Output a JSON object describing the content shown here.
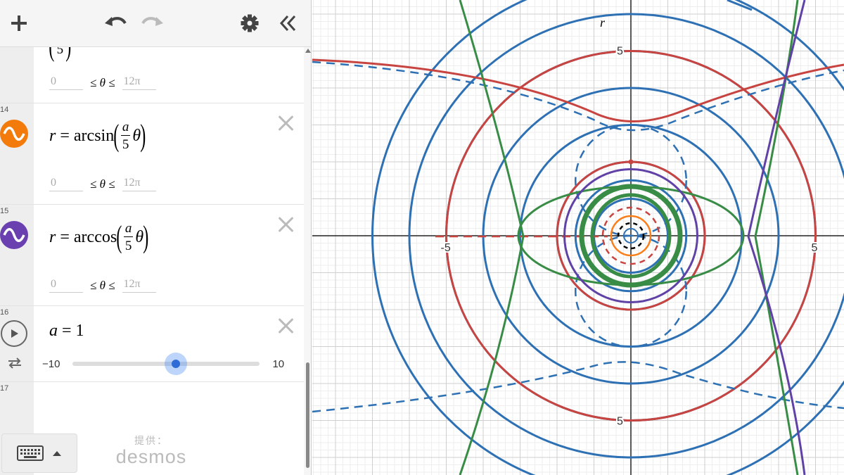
{
  "toolbar": {
    "add_icon": "plus-icon",
    "undo_icon": "undo-icon",
    "redo_icon": "redo-icon",
    "settings_icon": "gear-icon",
    "collapse_icon": "double-chevron-left-icon"
  },
  "expressions": {
    "partial": {
      "frac_den": "5",
      "dom_min": "0",
      "dom_max": "12π",
      "dom_var": "θ"
    },
    "e14": {
      "num": "14",
      "color": "#f27b0c",
      "lhs": "r",
      "func": "arcsin",
      "frac_num": "a",
      "frac_den": "5",
      "var": "θ",
      "dom_min": "0",
      "dom_max": "12π",
      "dom_var": "θ"
    },
    "e15": {
      "num": "15",
      "color": "#6a3fb0",
      "lhs": "r",
      "func": "arccos",
      "frac_num": "a",
      "frac_den": "5",
      "var": "θ",
      "dom_min": "0",
      "dom_max": "12π",
      "dom_var": "θ"
    },
    "e16": {
      "num": "16",
      "lhs": "a",
      "eq": "= 1",
      "slider_min": "−10",
      "slider_max": "10",
      "slider_value": 1
    },
    "e17": {
      "num": "17"
    }
  },
  "footer": {
    "keyboard_icon": "keyboard-icon",
    "powered_by": "提供：",
    "brand": "desmos"
  },
  "graph": {
    "x_label": "r",
    "x_ticks": [
      "-5",
      "5"
    ],
    "y_ticks": [
      "5",
      "5"
    ],
    "colors": {
      "blue": "#2d70b3",
      "red": "#c74440",
      "green": "#388c46",
      "purple": "#6042a6",
      "orange": "#fa7e19",
      "black": "#000000"
    }
  }
}
